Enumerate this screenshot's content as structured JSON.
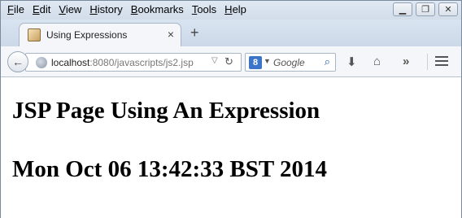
{
  "menu": [
    "File",
    "Edit",
    "View",
    "History",
    "Bookmarks",
    "Tools",
    "Help"
  ],
  "menu_underline": [
    "F",
    "E",
    "V",
    "H",
    "B",
    "T",
    "H"
  ],
  "window_controls": {
    "minimize": "▁",
    "restore": "❐",
    "close": "✕"
  },
  "tab": {
    "title": "Using Expressions",
    "close": "×"
  },
  "new_tab": "+",
  "nav": {
    "url_host": "localhost",
    "url_rest": ":8080/javascripts/js2.jsp",
    "url_dropdown": "▽",
    "reload": "↻",
    "search_placeholder": "Google",
    "search_engine_letter": "8",
    "search_icon": "🔍"
  },
  "toolbar_icons": [
    "download-icon",
    "home-icon",
    "overflow-icon",
    "menu-icon"
  ],
  "page": {
    "heading1": "JSP Page Using An Expression",
    "heading2": "Mon Oct 06 13:42:33 BST 2014"
  },
  "colors": {
    "titlebar": "#d2dde9",
    "content_bg": "#ffffff"
  }
}
